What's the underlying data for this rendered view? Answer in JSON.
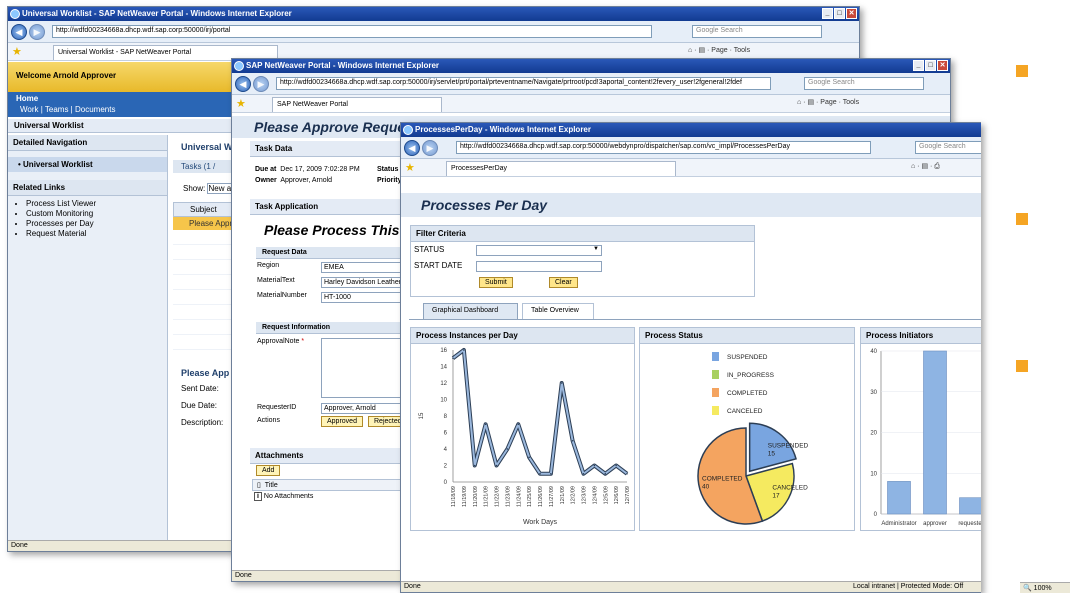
{
  "w1": {
    "title": "Universal Worklist - SAP NetWeaver Portal - Windows Internet Explorer",
    "url": "http://wdfd00234668a.dhcp.wdf.sap.corp:50000/irj/portal",
    "search": "Google Search",
    "tab": "Universal Worklist - SAP NetWeaver Portal",
    "welcome": "Welcome Arnold Approver",
    "home": "Home",
    "subnav": "Work | Teams | Documents",
    "worklist": "Universal Worklist",
    "detailed_nav": "Detailed Navigation",
    "uwl_item": "• Universal Worklist",
    "related": "Related Links",
    "links": [
      "Process List Viewer",
      "Custom Monitoring",
      "Processes per Day",
      "Request Material"
    ],
    "main_title": "Universal W",
    "tasks_tab": "Tasks (1 /",
    "show": "Show:",
    "show_val": "New a",
    "subject": "Subject",
    "row": "Please Appro",
    "detail_title": "Please App",
    "sent": "Sent Date:",
    "due": "Due Date:",
    "desc": "Description:",
    "status": "Done",
    "page": "Page",
    "tools": "Tools"
  },
  "w2": {
    "title": "SAP NetWeaver Portal - Windows Internet Explorer",
    "url": "http://wdfd00234668a.dhcp.wdf.sap.corp:50000/irj/servlet/prt/portal/prteventname/Navigate/prtroot/pcd!3aportal_content!2fevery_user!2fgeneral!2fdef",
    "search": "Google Search",
    "tab": "SAP NetWeaver Portal",
    "page": "Page",
    "tools": "Tools",
    "heading": "Please Approve Reque",
    "task_data": "Task Data",
    "due_lbl": "Due at",
    "due_val": "Dec 17, 2009 7:02:28 PM",
    "owner_lbl": "Owner",
    "owner_val": "Approver, Arnold",
    "status_lbl": "Status",
    "prio_lbl": "Priority",
    "task_app": "Task Application",
    "process_title": "Please Process This",
    "req_data": "Request Data",
    "region_lbl": "Region",
    "region_val": "EMEA",
    "mat_lbl": "MaterialText",
    "mat_val": "Harley Davidson Leather",
    "num_lbl": "MaterialNumber",
    "num_val": "HT-1000",
    "req_info": "Request Information",
    "note_lbl": "ApprovalNote",
    "req_id_lbl": "RequesterID",
    "req_id_val": "Approver, Arnold",
    "actions_lbl": "Actions",
    "approved": "Approved",
    "rejected": "Rejected",
    "attachments": "Attachments",
    "add": "Add",
    "col_title": "Title",
    "no_att": "No Attachments",
    "status": "Done"
  },
  "w3": {
    "title": "ProcessesPerDay - Windows Internet Explorer",
    "url": "http://wdfd00234668a.dhcp.wdf.sap.corp:50000/webdynpro/dispatcher/sap.com/vc_impl/ProcessesPerDay",
    "search": "Google Search",
    "tab": "ProcessesPerDay",
    "heading": "Processes Per Day",
    "filter": "Filter Criteria",
    "status_lbl": "STATUS",
    "start_lbl": "START DATE",
    "submit": "Submit",
    "clear": "Clear",
    "tab1": "Graphical Dashboard",
    "tab2": "Table Overview",
    "p1": "Process Instances per Day",
    "p2": "Process Status",
    "p3": "Process Initiators",
    "statusbar": "Done",
    "zone": "Local intranet | Protected Mode: Off",
    "zoom": "100%"
  },
  "chart_data": [
    {
      "type": "line",
      "title": "Process Instances per Day",
      "xlabel": "Work Days",
      "ylabel": "15",
      "ylim": [
        0,
        16
      ],
      "yticks": [
        0,
        2,
        4,
        6,
        8,
        10,
        12,
        14,
        16
      ],
      "categories": [
        "11/18/09",
        "11/19/09",
        "11/20/09",
        "11/21/09",
        "11/22/09",
        "11/23/09",
        "11/24/09",
        "11/25/09",
        "11/26/09",
        "11/27/09",
        "12/1/09",
        "12/2/09",
        "12/3/09",
        "12/4/09",
        "12/5/09",
        "12/6/09",
        "12/7/09"
      ],
      "values": [
        15,
        16,
        2,
        7,
        2,
        4,
        7,
        3,
        1,
        1,
        12,
        5,
        1,
        2,
        1,
        2,
        1
      ]
    },
    {
      "type": "pie",
      "title": "Process Status",
      "categories": [
        "SUSPENDED",
        "IN_PROGRESS",
        "COMPLETED",
        "CANCELED"
      ],
      "values": [
        15,
        0,
        40,
        17
      ],
      "colors": [
        "#79a5e0",
        "#a8d060",
        "#f4a460",
        "#f5ea60"
      ],
      "labels": [
        "SUSPENDED\n15",
        "",
        "COMPLETED\n40",
        "CANCELED\n17"
      ]
    },
    {
      "type": "bar",
      "title": "Process Initiators",
      "categories": [
        "Administrator",
        "approver",
        "requester"
      ],
      "values": [
        8,
        40,
        4
      ],
      "ylim": [
        0,
        40
      ],
      "yticks": [
        0,
        10,
        20,
        30,
        40
      ],
      "color": "#8eb4e3"
    }
  ]
}
